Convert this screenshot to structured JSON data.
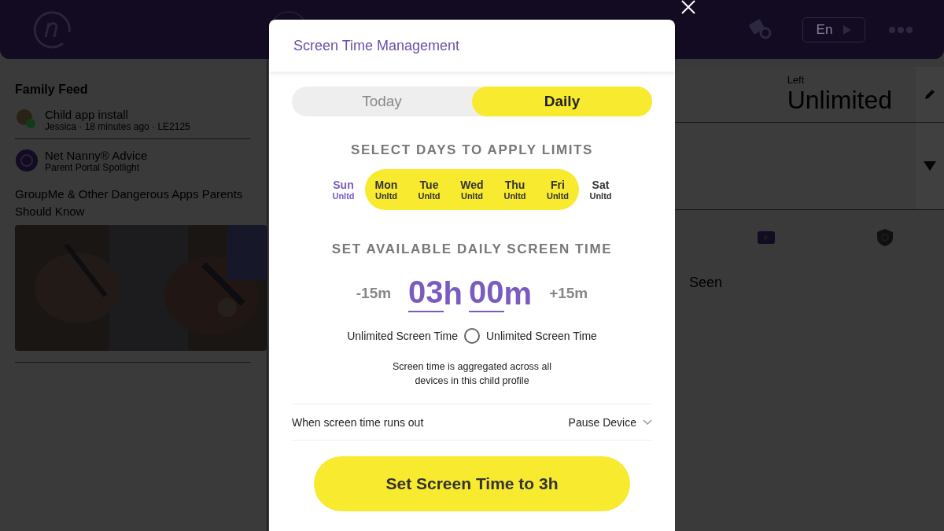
{
  "header": {
    "language": "En"
  },
  "feed": {
    "title": "Family Feed",
    "items": [
      {
        "kind": "app",
        "title": "Child app install",
        "meta": "Jessica · 18 minutes ago · LE2125"
      },
      {
        "kind": "advice",
        "title": "Net Nanny® Advice",
        "meta": "Parent Portal Spotlight",
        "headline": "GroupMe & Other Dangerous Apps Parents Should Know"
      }
    ]
  },
  "summary": {
    "label": "Left",
    "value": "Unlimited",
    "column_label": "Seen"
  },
  "modal": {
    "title": "Screen Time Management",
    "tabs": [
      {
        "label": "Today",
        "selected": false
      },
      {
        "label": "Daily",
        "selected": true
      }
    ],
    "days_heading": "SELECT DAYS TO APPLY LIMITS",
    "days": [
      {
        "name": "Sun",
        "limit": "Unltd",
        "selected": false,
        "current": true
      },
      {
        "name": "Mon",
        "limit": "Unltd",
        "selected": true,
        "current": false
      },
      {
        "name": "Tue",
        "limit": "Unltd",
        "selected": true,
        "current": false
      },
      {
        "name": "Wed",
        "limit": "Unltd",
        "selected": true,
        "current": false
      },
      {
        "name": "Thu",
        "limit": "Unltd",
        "selected": true,
        "current": false
      },
      {
        "name": "Fri",
        "limit": "Unltd",
        "selected": true,
        "current": false
      },
      {
        "name": "Sat",
        "limit": "Unltd",
        "selected": false,
        "current": false
      }
    ],
    "time_heading": "SET AVAILABLE DAILY SCREEN TIME",
    "decrease": "-15m",
    "hours": "03",
    "hours_unit": "h",
    "minutes": "00",
    "minutes_unit": "m",
    "increase": "+15m",
    "unlimited": {
      "label_left": "Unlimited Screen Time",
      "label_right": "Unlimited Screen Time",
      "checked": false
    },
    "note": "Screen time is aggregated across all devices in this child profile",
    "runs_out": {
      "label": "When screen time runs out",
      "value": "Pause Device"
    },
    "submit": "Set Screen Time to 3h"
  }
}
